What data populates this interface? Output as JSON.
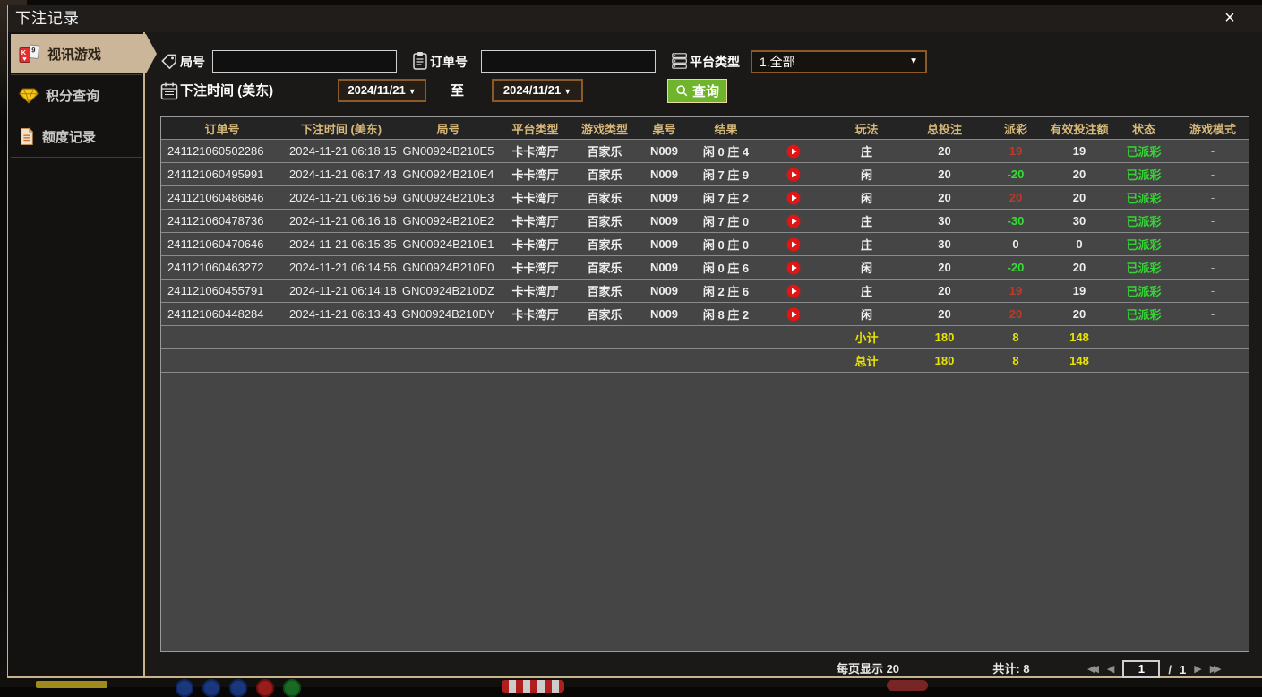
{
  "dialog": {
    "title": "下注记录",
    "close_icon": "×"
  },
  "sidebar": {
    "items": [
      {
        "label": "视讯游戏",
        "icon": "playing-cards-icon",
        "active": true
      },
      {
        "label": "积分查询",
        "icon": "diamond-icon",
        "active": false
      },
      {
        "label": "额度记录",
        "icon": "document-icon",
        "active": false
      }
    ]
  },
  "filters": {
    "round_label": "局号",
    "round_value": "",
    "order_label": "订单号",
    "order_value": "",
    "platform_label": "平台类型",
    "platform_selected": "1.全部",
    "time_label": "下注时间 (美东)",
    "date_from": "2024/11/21",
    "to_label": "至",
    "date_to": "2024/11/21",
    "query_label": "查询",
    "dropdown_arrow": "▼"
  },
  "table": {
    "headers": [
      "订单号",
      "下注时间 (美东)",
      "局号",
      "平台类型",
      "游戏类型",
      "桌号",
      "结果",
      "玩法",
      "总投注",
      "派彩",
      "有效投注额",
      "状态",
      "游戏模式"
    ],
    "rows": [
      {
        "order": "241121060502286",
        "time": "2024-11-21 06:18:15",
        "round": "GN00924B210E5",
        "platform": "卡卡湾厅",
        "game": "百家乐",
        "table_no": "N009",
        "result": "闲 0 庄 4",
        "play": "庄",
        "total_bet": "20",
        "payout": "19",
        "payout_tone": "win",
        "valid_bet": "19",
        "status": "已派彩",
        "mode": "-"
      },
      {
        "order": "241121060495991",
        "time": "2024-11-21 06:17:43",
        "round": "GN00924B210E4",
        "platform": "卡卡湾厅",
        "game": "百家乐",
        "table_no": "N009",
        "result": "闲 7 庄 9",
        "play": "闲",
        "total_bet": "20",
        "payout": "-20",
        "payout_tone": "loss",
        "valid_bet": "20",
        "status": "已派彩",
        "mode": "-"
      },
      {
        "order": "241121060486846",
        "time": "2024-11-21 06:16:59",
        "round": "GN00924B210E3",
        "platform": "卡卡湾厅",
        "game": "百家乐",
        "table_no": "N009",
        "result": "闲 7 庄 2",
        "play": "闲",
        "total_bet": "20",
        "payout": "20",
        "payout_tone": "win",
        "valid_bet": "20",
        "status": "已派彩",
        "mode": "-"
      },
      {
        "order": "241121060478736",
        "time": "2024-11-21 06:16:16",
        "round": "GN00924B210E2",
        "platform": "卡卡湾厅",
        "game": "百家乐",
        "table_no": "N009",
        "result": "闲 7 庄 0",
        "play": "庄",
        "total_bet": "30",
        "payout": "-30",
        "payout_tone": "loss",
        "valid_bet": "30",
        "status": "已派彩",
        "mode": "-"
      },
      {
        "order": "241121060470646",
        "time": "2024-11-21 06:15:35",
        "round": "GN00924B210E1",
        "platform": "卡卡湾厅",
        "game": "百家乐",
        "table_no": "N009",
        "result": "闲 0 庄 0",
        "play": "庄",
        "total_bet": "30",
        "payout": "0",
        "payout_tone": "zero",
        "valid_bet": "0",
        "status": "已派彩",
        "mode": "-"
      },
      {
        "order": "241121060463272",
        "time": "2024-11-21 06:14:56",
        "round": "GN00924B210E0",
        "platform": "卡卡湾厅",
        "game": "百家乐",
        "table_no": "N009",
        "result": "闲 0 庄 6",
        "play": "闲",
        "total_bet": "20",
        "payout": "-20",
        "payout_tone": "loss",
        "valid_bet": "20",
        "status": "已派彩",
        "mode": "-"
      },
      {
        "order": "241121060455791",
        "time": "2024-11-21 06:14:18",
        "round": "GN00924B210DZ",
        "platform": "卡卡湾厅",
        "game": "百家乐",
        "table_no": "N009",
        "result": "闲 2 庄 6",
        "play": "庄",
        "total_bet": "20",
        "payout": "19",
        "payout_tone": "win",
        "valid_bet": "19",
        "status": "已派彩",
        "mode": "-"
      },
      {
        "order": "241121060448284",
        "time": "2024-11-21 06:13:43",
        "round": "GN00924B210DY",
        "platform": "卡卡湾厅",
        "game": "百家乐",
        "table_no": "N009",
        "result": "闲 8 庄 2",
        "play": "闲",
        "total_bet": "20",
        "payout": "20",
        "payout_tone": "win",
        "valid_bet": "20",
        "status": "已派彩",
        "mode": "-"
      }
    ],
    "subtotal": {
      "label": "小计",
      "total_bet": "180",
      "payout": "8",
      "valid_bet": "148"
    },
    "grand_total": {
      "label": "总计",
      "total_bet": "180",
      "payout": "8",
      "valid_bet": "148"
    }
  },
  "pagination": {
    "per_page": "每页显示 20",
    "total_count": "共计: 8",
    "current_page": "1",
    "separator": "/",
    "total_pages": "1"
  },
  "colors": {
    "accent_gold": "#d8b878",
    "tab_active_bg": "#cbb69a",
    "win_red": "#c0392b",
    "loss_green": "#33dd33",
    "status_green": "#35d435",
    "summary_yellow": "#e8e400",
    "button_green": "#6fb52c",
    "date_border": "#8a5a2b",
    "border_tan": "#c6b28c"
  }
}
